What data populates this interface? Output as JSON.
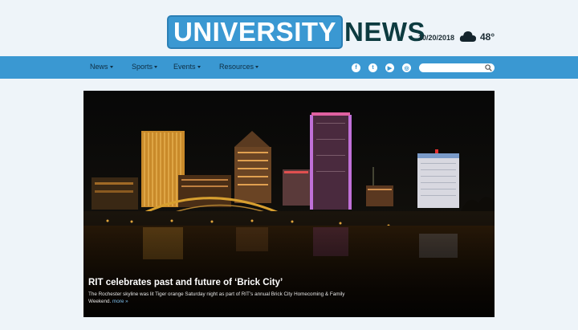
{
  "header": {
    "logo_part1": "UNIVERSITY",
    "logo_part2": "NEWS",
    "date": "10/20/2018",
    "weather_icon": "cloud-icon",
    "temperature": "48°"
  },
  "nav": {
    "items": [
      {
        "label": "News"
      },
      {
        "label": "Sports"
      },
      {
        "label": "Events"
      },
      {
        "label": "Resources"
      }
    ],
    "social": [
      {
        "icon": "facebook-icon",
        "glyph": "f"
      },
      {
        "icon": "twitter-icon",
        "glyph": "t"
      },
      {
        "icon": "youtube-icon",
        "glyph": "▶"
      },
      {
        "icon": "instagram-icon",
        "glyph": "◎"
      }
    ],
    "search": {
      "placeholder": "",
      "icon": "search-icon"
    }
  },
  "hero": {
    "headline": "RIT celebrates past and future of ‘Brick City’",
    "excerpt": "The Rochester skyline was lit Tiger orange Saturday night as part of RIT’s annual Brick City Homecoming & Family Weekend.",
    "more_label": "more »"
  },
  "colors": {
    "brand_blue": "#3a98d2",
    "brand_dark": "#0d3b40",
    "page_bg": "#eef4f9"
  }
}
